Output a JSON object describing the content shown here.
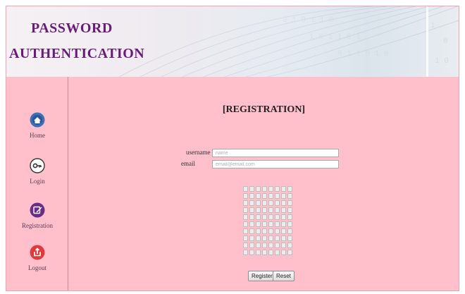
{
  "header": {
    "title_line1": "PASSWORD",
    "title_line2": "AUTHENTICATION"
  },
  "sidebar": {
    "items": [
      {
        "label": "Home",
        "icon": "home-icon",
        "color": "#3d6fb6"
      },
      {
        "label": "Login",
        "icon": "key-icon",
        "color": "#ffffff"
      },
      {
        "label": "Registration",
        "icon": "edit-icon",
        "color": "#6a2c8a"
      },
      {
        "label": "Logout",
        "icon": "logout-icon",
        "color": "#e03a3a"
      }
    ]
  },
  "main": {
    "title": "[REGISTRATION]",
    "username_label": "username",
    "username_placeholder": "name",
    "email_label": "email",
    "email_placeholder": "email@email.com",
    "grid": {
      "rows": 10,
      "cols": 8
    },
    "register_button": "Register",
    "reset_button": "Reset"
  },
  "colors": {
    "background": "#ffc0cb",
    "title": "#6a1b7a"
  }
}
